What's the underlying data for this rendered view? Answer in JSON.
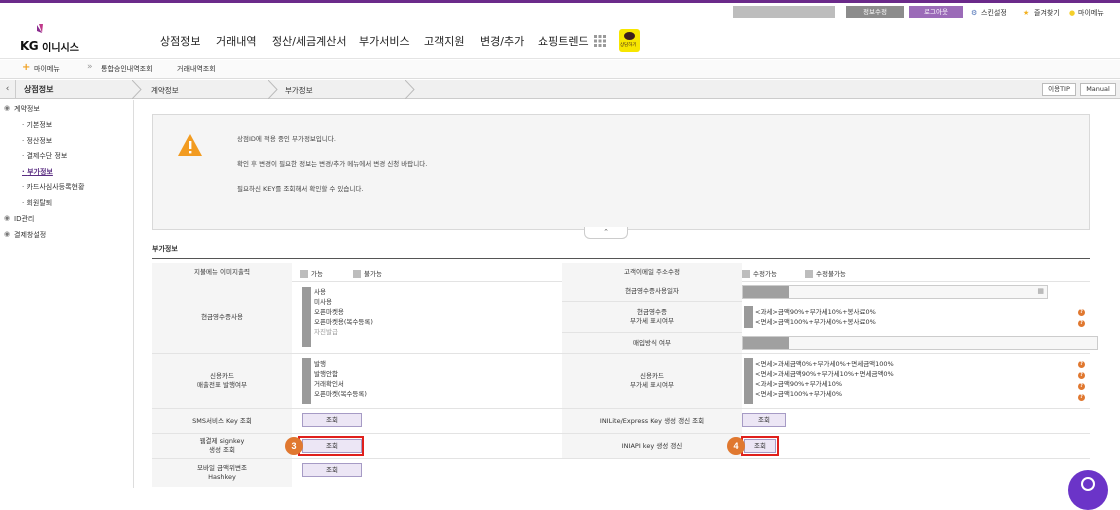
{
  "header": {
    "util": {
      "edit_info": "정보수정",
      "logout": "로그아웃",
      "skin": "스킨설정",
      "favorites": "즐겨찾기",
      "mymenu": "마이메뉴"
    },
    "logo": {
      "kg": "KG",
      "name": "이니시스"
    },
    "menu": [
      "상점정보",
      "거래내역",
      "정산/세금계산서",
      "부가서비스",
      "고객지원",
      "변경/추가",
      "쇼핑트렌드"
    ],
    "kakao_label": "상담하기"
  },
  "subnav": {
    "mymenu": "마이메뉴",
    "items": [
      "통합승인내역조회",
      "거래내역조회"
    ]
  },
  "breadcrumb": {
    "section": "상점정보",
    "items": [
      "계약정보",
      "부가정보"
    ],
    "tip": "이용TIP",
    "manual": "Manual"
  },
  "sidebar": {
    "groups": [
      {
        "label": "계약정보",
        "children": [
          "기본정보",
          "정산정보",
          "결제수단 정보",
          "부가정보",
          "카드사심사등록현황",
          "회원탈퇴"
        ]
      },
      {
        "label": "ID관리"
      },
      {
        "label": "결제창설정"
      }
    ],
    "active": "부가정보"
  },
  "notice": {
    "lines": [
      "상점ID에 적용 중인 부가정보입니다.",
      "확인 후 변경이 필요한 정보는 변경/추가 메뉴에서 변경 신청 바랍니다.",
      "필요하신 KEY를 조회해서 확인할 수 있습니다."
    ]
  },
  "section_title": "부가정보",
  "table": {
    "r1": {
      "l_label": "지불메뉴 이미지출력",
      "l_opts": [
        "가능",
        "불가능"
      ],
      "r_label": "고객이메일 주소수정",
      "r_opts": [
        "수정가능",
        "수정불가능"
      ]
    },
    "r2": {
      "l_label": "현금영수증사용",
      "l_opts": [
        "사용",
        "미사용",
        "오픈마켓용",
        "오픈마켓용(복수등록)",
        "자진발급"
      ],
      "r_label_a": "현금영수증사용일자",
      "r_label_b": "현금영수증\n부가세 표시여부",
      "r_items_b": [
        "<과세>금액90%+부가세10%+봉사료0%",
        "<면세>금액100%+부가세0%+봉사료0%"
      ],
      "r_label_c": "매입방식 여부"
    },
    "r3": {
      "l_label": "신용카드\n매출전표 발행여부",
      "l_opts": [
        "발행",
        "발행안함",
        "거래확인서",
        "오픈마켓(복수등록)"
      ],
      "r_label": "신용카드\n부가세 표시여부",
      "r_items": [
        "<면세>과세금액0%+부가세0%+면세금액100%",
        "<면세>과세금액90%+부가세10%+면세금액0%",
        "<과세>금액90%+부가세10%",
        "<면세>금액100%+부가세0%"
      ]
    },
    "r4": {
      "l_label": "SMS서비스 Key 조회",
      "btn": "조회",
      "r_label": "INILite/Express Key  생성 갱신 조회",
      "r_btn": "조회"
    },
    "r5": {
      "l_label": "웹결제 signkey\n생성 조회",
      "btn": "조회",
      "badge": "3",
      "r_label": "INIAPI key 생성 갱신",
      "r_btn": "조회",
      "r_badge": "4"
    },
    "r6": {
      "l_label": "모바일 금액위변조\nHashkey",
      "btn": "조회"
    }
  },
  "colors": {
    "brand": "#6b2a8a",
    "highlight": "#e0201c",
    "badge": "#e07830"
  }
}
